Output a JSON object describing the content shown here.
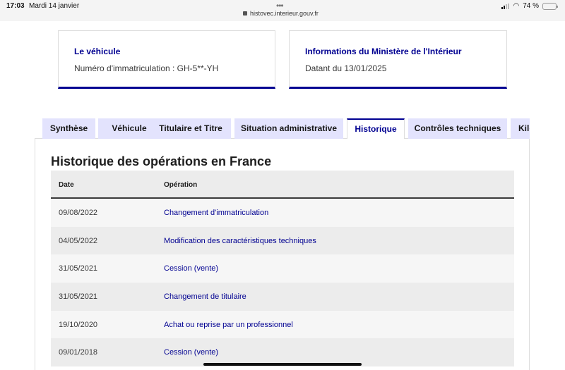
{
  "statusbar": {
    "time": "17:03",
    "date": "Mardi 14 janvier",
    "url": "histovec.interieur.gouv.fr",
    "battery": "74 %",
    "battery_level": 0.74
  },
  "cards": {
    "vehicle": {
      "title": "Le véhicule",
      "text": "Numéro d'immatriculation : GH-5**-YH"
    },
    "ministry": {
      "title": "Informations du Ministère de l'Intérieur",
      "text": "Datant du 13/01/2025"
    }
  },
  "tabs": [
    {
      "label": "Synthèse"
    },
    {
      "label": "Véhicule"
    },
    {
      "label": "Titulaire et Titre"
    },
    {
      "label": "Situation administrative"
    },
    {
      "label": "Historique"
    },
    {
      "label": "Contrôles techniques"
    },
    {
      "label": "Kilo"
    }
  ],
  "history": {
    "title": "Historique des opérations en France",
    "headers": {
      "date": "Date",
      "operation": "Opération"
    },
    "rows": [
      {
        "date": "09/08/2022",
        "operation": "Changement d'immatriculation"
      },
      {
        "date": "04/05/2022",
        "operation": "Modification des caractéristiques techniques"
      },
      {
        "date": "31/05/2021",
        "operation": "Cession (vente)"
      },
      {
        "date": "31/05/2021",
        "operation": "Changement de titulaire"
      },
      {
        "date": "19/10/2020",
        "operation": "Achat ou reprise par un professionnel"
      },
      {
        "date": "09/01/2018",
        "operation": "Cession (vente)"
      }
    ]
  },
  "colors": {
    "accent": "#000091",
    "tab_bg": "#e3e3fd"
  }
}
